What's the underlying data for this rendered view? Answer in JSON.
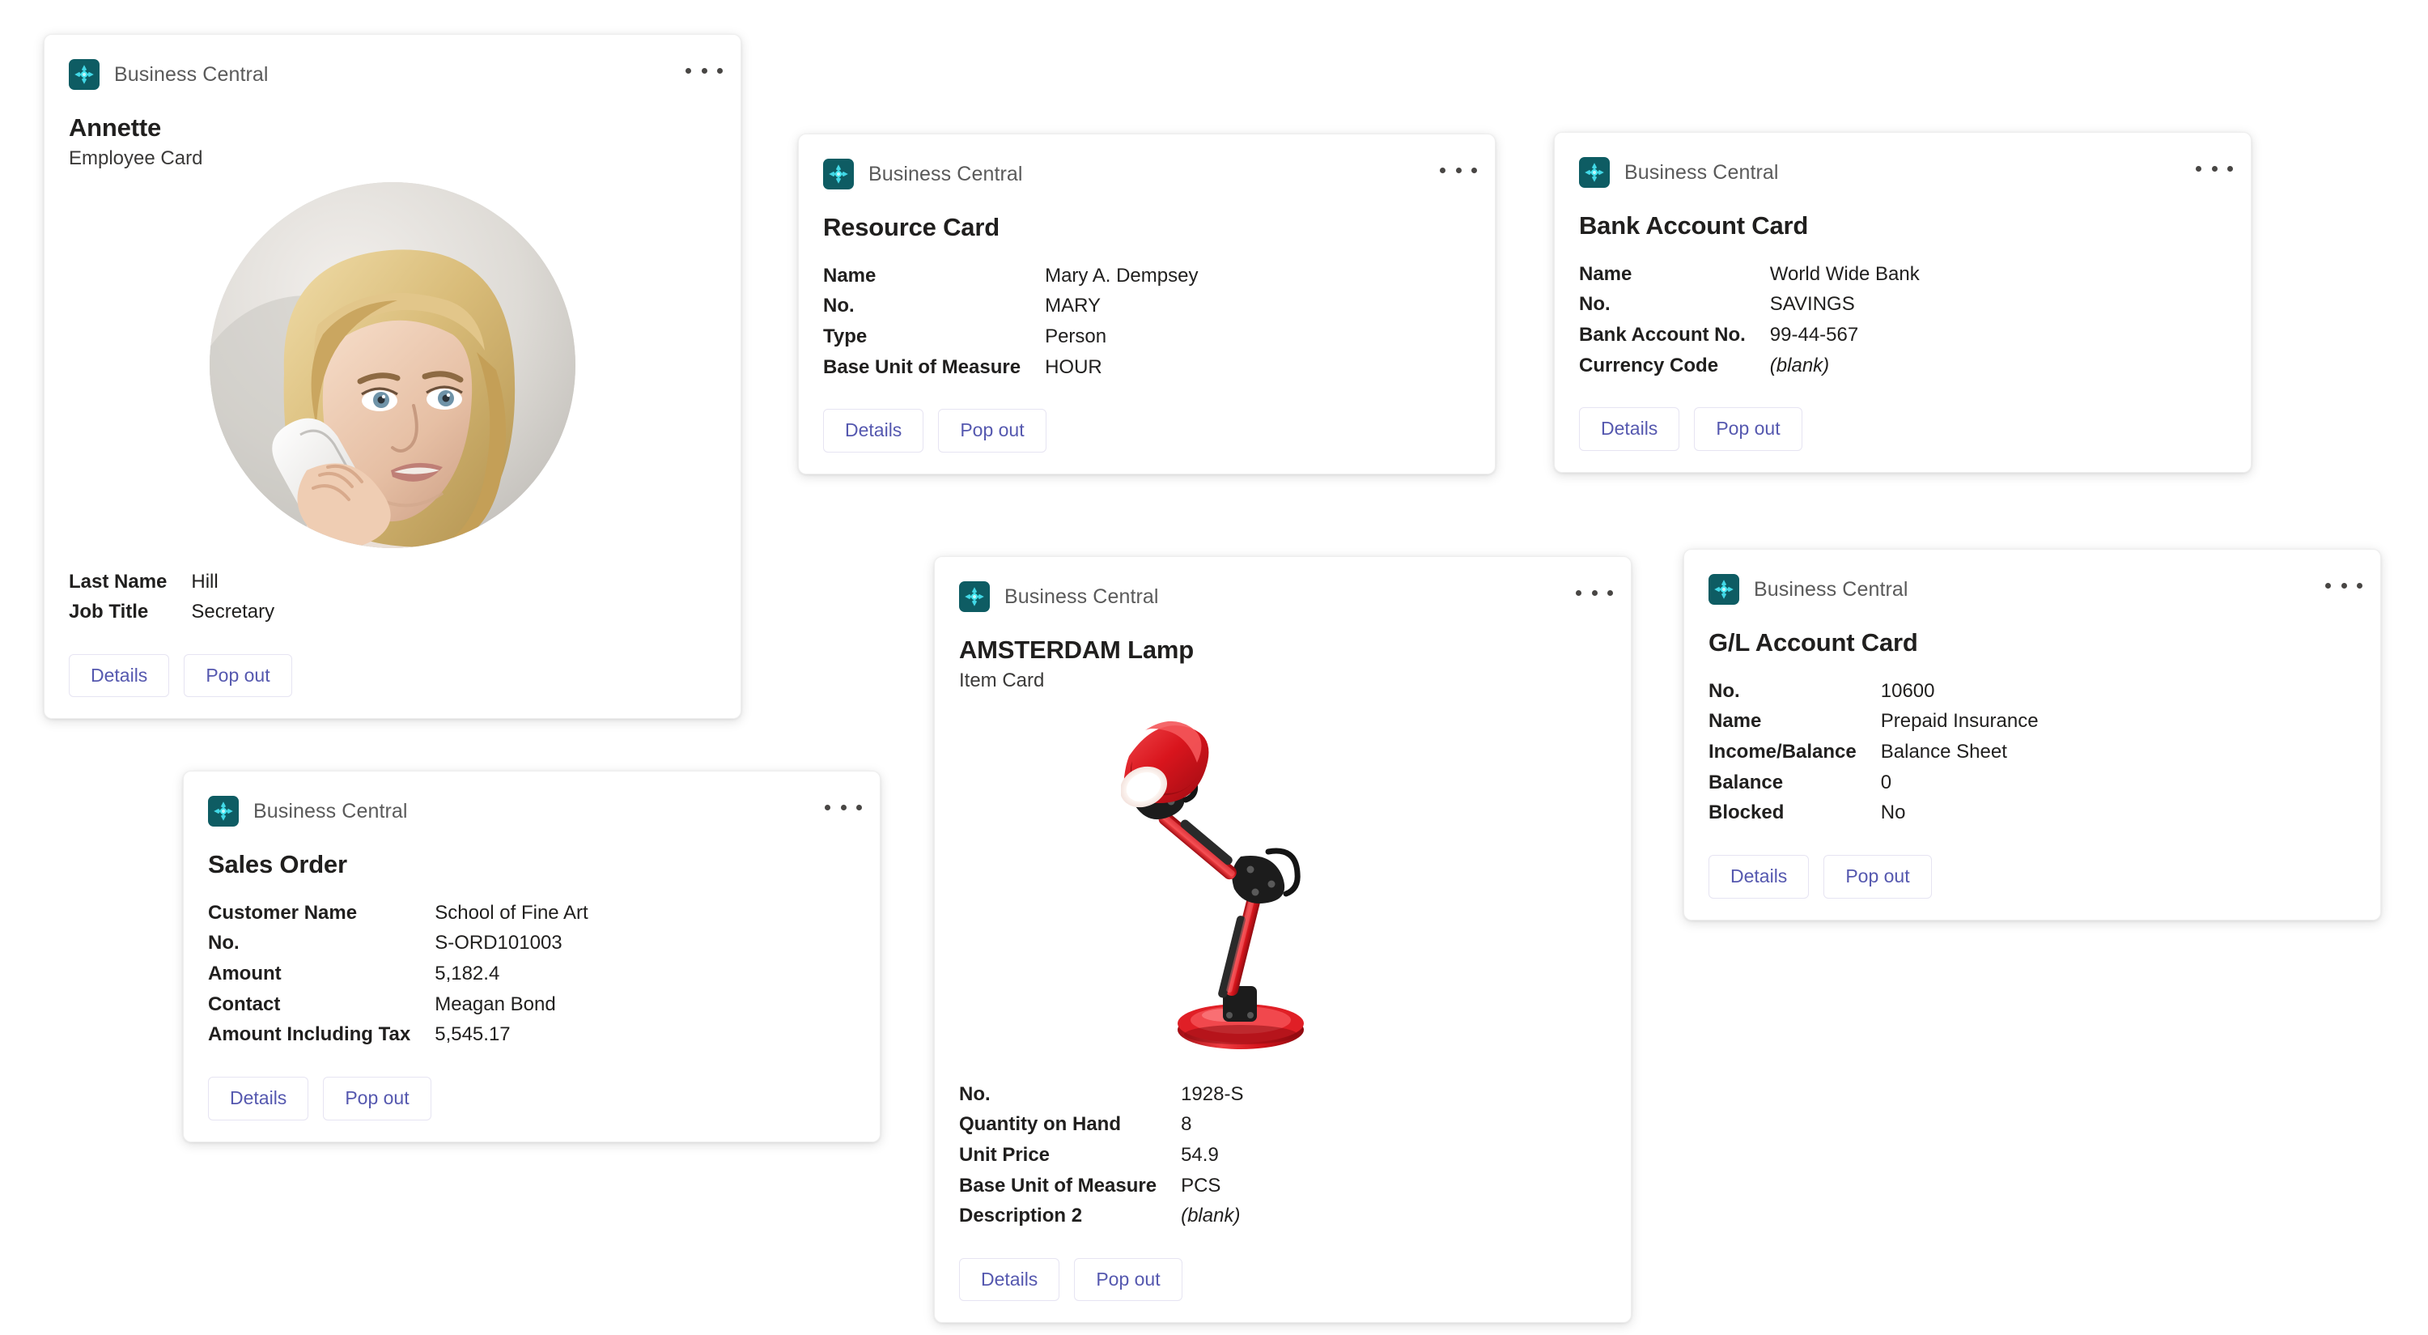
{
  "app": {
    "name": "Business Central",
    "logo_icon": "business-central-diamond-icon",
    "logo_bg": "#0E5C63",
    "logo_accent": "#1ED3E0",
    "overflow_icon": "more-options-ellipsis-icon",
    "accent_button_text": "#5558af",
    "button_border": "#e6e4f2"
  },
  "common": {
    "details_label": "Details",
    "popout_label": "Pop out",
    "blank_value": "(blank)"
  },
  "cards": [
    {
      "id": "employee",
      "title": "Annette",
      "subtitle": "Employee Card",
      "media": "employee-photo",
      "media_alt": "Blonde woman holding a white telephone handset",
      "facts": [
        {
          "key": "Last Name",
          "value": "Hill"
        },
        {
          "key": "Job Title",
          "value": "Secretary"
        }
      ]
    },
    {
      "id": "resource",
      "title": "Resource Card",
      "subtitle": "",
      "facts": [
        {
          "key": "Name",
          "value": "Mary A. Dempsey"
        },
        {
          "key": "No.",
          "value": "MARY"
        },
        {
          "key": "Type",
          "value": "Person"
        },
        {
          "key": "Base Unit of Measure",
          "value": "HOUR"
        }
      ]
    },
    {
      "id": "bank",
      "title": "Bank Account Card",
      "subtitle": "",
      "facts": [
        {
          "key": "Name",
          "value": "World Wide Bank"
        },
        {
          "key": "No.",
          "value": "SAVINGS"
        },
        {
          "key": "Bank Account No.",
          "value": "99-44-567"
        },
        {
          "key": "Currency Code",
          "value": "(blank)",
          "blank": true
        }
      ]
    },
    {
      "id": "sales",
      "title": "Sales Order",
      "subtitle": "",
      "facts": [
        {
          "key": "Customer Name",
          "value": "School of Fine Art"
        },
        {
          "key": "No.",
          "value": "S-ORD101003"
        },
        {
          "key": "Amount",
          "value": "5,182.4"
        },
        {
          "key": "Contact",
          "value": "Meagan Bond"
        },
        {
          "key": "Amount Including Tax",
          "value": "5,545.17"
        }
      ]
    },
    {
      "id": "item",
      "title": "AMSTERDAM Lamp",
      "subtitle": "Item Card",
      "media": "item-photo",
      "media_alt": "Red articulated desk lamp",
      "facts": [
        {
          "key": "No.",
          "value": "1928-S"
        },
        {
          "key": "Quantity on Hand",
          "value": "8"
        },
        {
          "key": "Unit Price",
          "value": "54.9"
        },
        {
          "key": "Base Unit of Measure",
          "value": "PCS"
        },
        {
          "key": "Description 2",
          "value": "(blank)",
          "blank": true
        }
      ]
    },
    {
      "id": "gl",
      "title": "G/L Account Card",
      "subtitle": "",
      "facts": [
        {
          "key": "No.",
          "value": "10600"
        },
        {
          "key": "Name",
          "value": "Prepaid Insurance"
        },
        {
          "key": "Income/Balance",
          "value": "Balance Sheet"
        },
        {
          "key": "Balance",
          "value": "0"
        },
        {
          "key": "Blocked",
          "value": "No"
        }
      ]
    }
  ]
}
